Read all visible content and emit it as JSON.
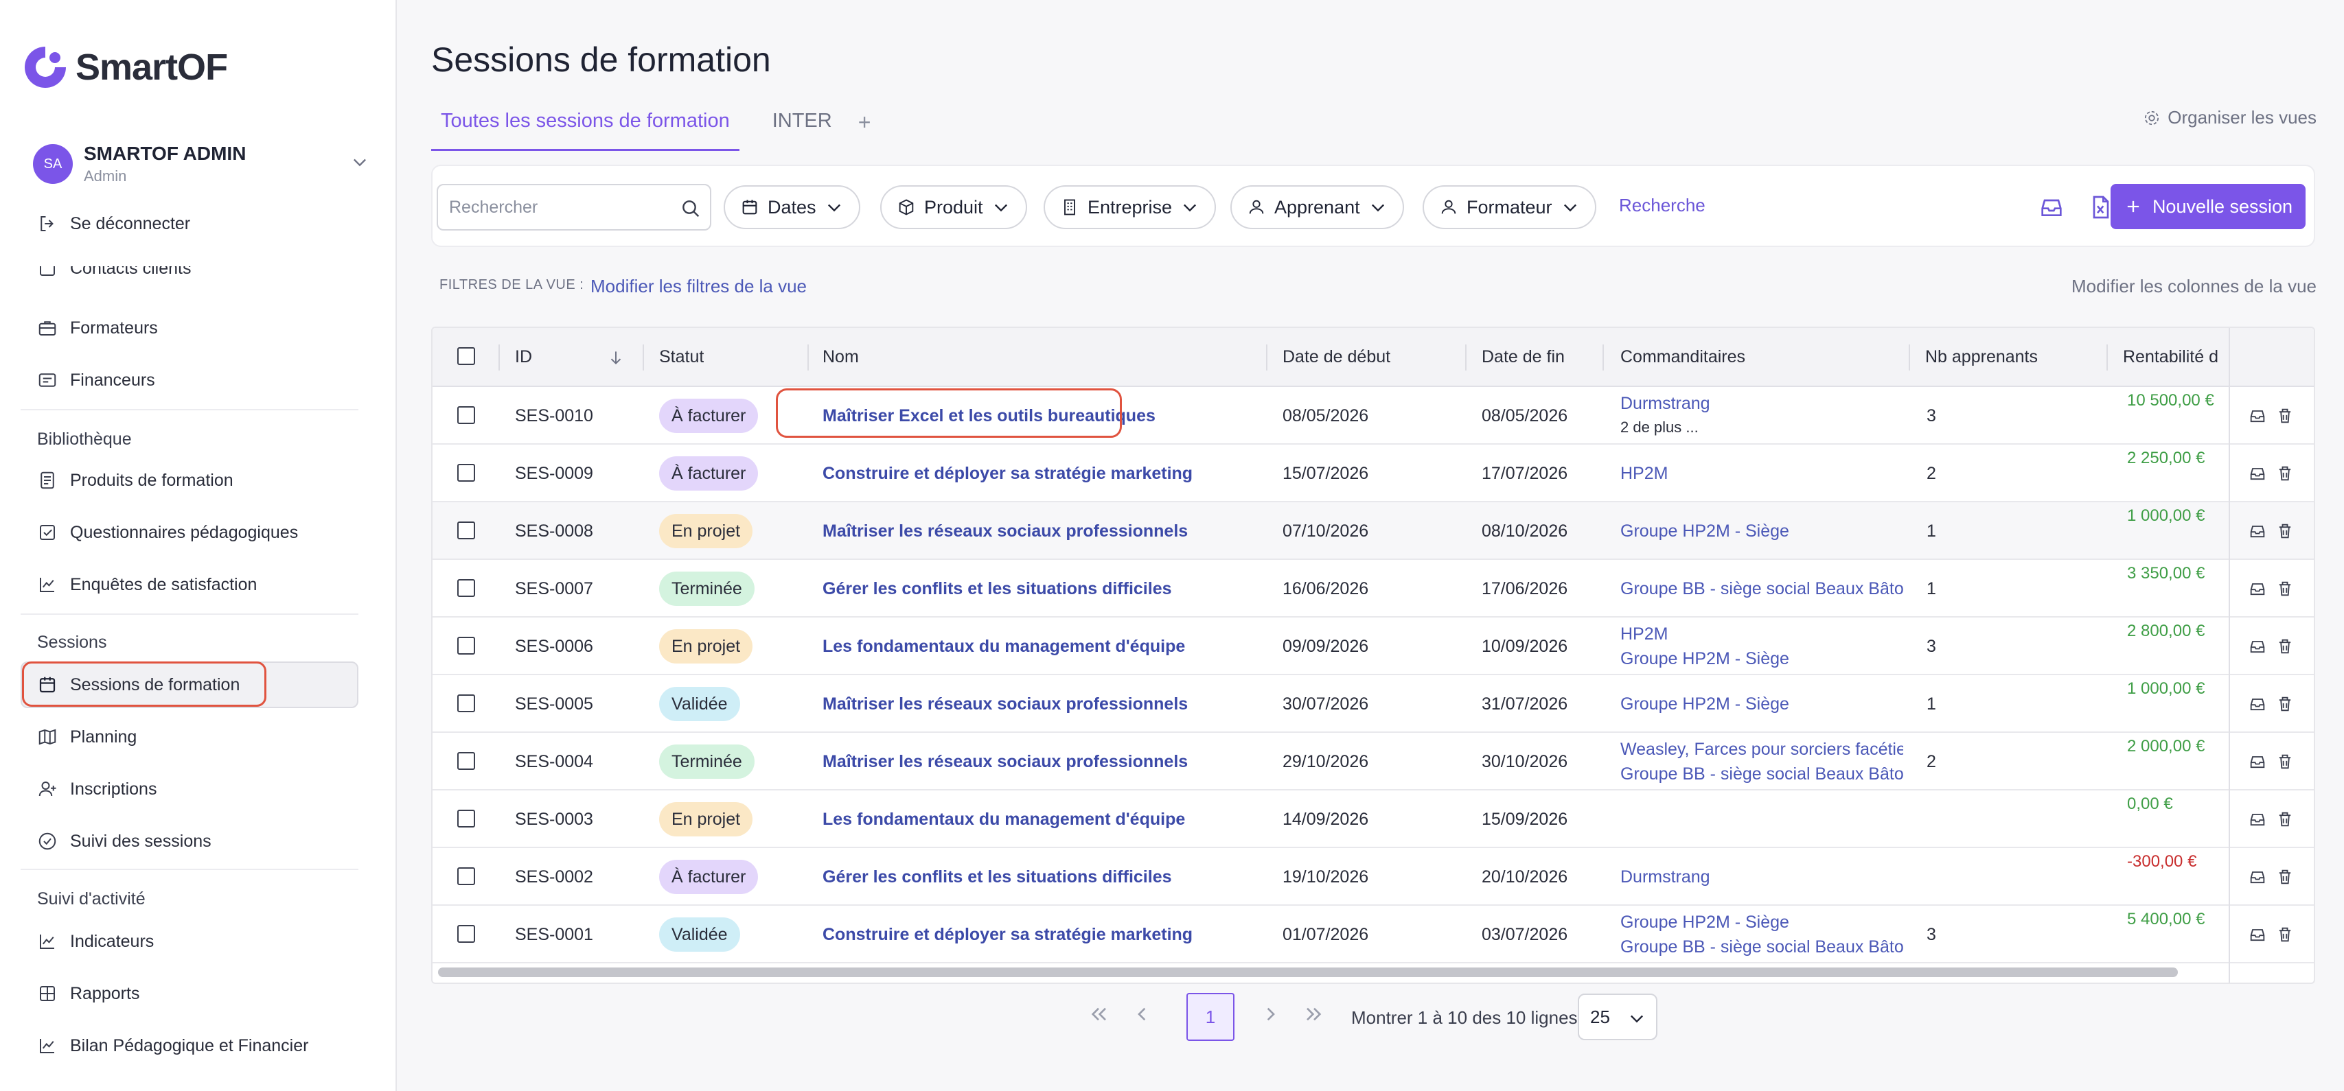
{
  "brand": {
    "name": "SmartOF"
  },
  "user": {
    "initials": "SA",
    "name": "SMARTOF ADMIN",
    "role": "Admin"
  },
  "sidebar": {
    "logout": "Se déconnecter",
    "partial": "Contacts clients",
    "items_top": [
      "Formateurs",
      "Financeurs"
    ],
    "section_library": "Bibliothèque",
    "items_library": [
      "Produits de formation",
      "Questionnaires pédagogiques",
      "Enquêtes de satisfaction"
    ],
    "section_sessions": "Sessions",
    "items_sessions": [
      "Sessions de formation",
      "Planning",
      "Inscriptions",
      "Suivi des sessions"
    ],
    "section_activity": "Suivi d'activité",
    "items_activity": [
      "Indicateurs",
      "Rapports",
      "Bilan Pédagogique et Financier"
    ]
  },
  "page": {
    "title": "Sessions de formation"
  },
  "tabs": [
    "Toutes les sessions de formation",
    "INTER"
  ],
  "tab_add": "+",
  "organize": "Organiser les vues",
  "toolbar": {
    "search_placeholder": "Rechercher",
    "filters": [
      "Dates",
      "Produit",
      "Entreprise",
      "Apprenant",
      "Formateur"
    ],
    "search_link": "Recherche",
    "new_session": "Nouvelle session"
  },
  "view": {
    "filters_label": "FILTRES DE LA VUE :",
    "filters_link": "Modifier les filtres de la vue",
    "columns_link": "Modifier les colonnes de la vue"
  },
  "table": {
    "columns": [
      "ID",
      "Statut",
      "Nom",
      "Date de début",
      "Date de fin",
      "Commanditaires",
      "Nb apprenants",
      "Rentabilité d"
    ],
    "rows": [
      {
        "id": "SES-0010",
        "status": "À facturer",
        "kind": "facturer",
        "name": "Maîtriser Excel et les outils bureautiques",
        "start": "08/05/2026",
        "end": "08/05/2026",
        "sponsor1": "Durmstrang",
        "sponsor2": "2 de plus ...",
        "count": "3",
        "profit": "10 500,00 €"
      },
      {
        "id": "SES-0009",
        "status": "À facturer",
        "kind": "facturer",
        "name": "Construire et déployer sa stratégie marketing",
        "start": "15/07/2026",
        "end": "17/07/2026",
        "sponsor1": "HP2M",
        "sponsor2": "",
        "count": "2",
        "profit": "2 250,00 €"
      },
      {
        "id": "SES-0008",
        "status": "En projet",
        "kind": "projet",
        "name": "Maîtriser les réseaux sociaux professionnels",
        "start": "07/10/2026",
        "end": "08/10/2026",
        "sponsor1": "Groupe HP2M - Siège",
        "sponsor2": "",
        "count": "1",
        "profit": "1 000,00 €"
      },
      {
        "id": "SES-0007",
        "status": "Terminée",
        "kind": "terminee",
        "name": "Gérer les conflits et les situations difficiles",
        "start": "16/06/2026",
        "end": "17/06/2026",
        "sponsor1": "Groupe BB - siège social Beaux Bâto",
        "sponsor2": "",
        "count": "1",
        "profit": "3 350,00 €"
      },
      {
        "id": "SES-0006",
        "status": "En projet",
        "kind": "projet",
        "name": "Les fondamentaux du management d'équipe",
        "start": "09/09/2026",
        "end": "10/09/2026",
        "sponsor1": "HP2M",
        "sponsor2": "Groupe HP2M - Siège",
        "count": "3",
        "profit": "2 800,00 €"
      },
      {
        "id": "SES-0005",
        "status": "Validée",
        "kind": "validee",
        "name": "Maîtriser les réseaux sociaux professionnels",
        "start": "30/07/2026",
        "end": "31/07/2026",
        "sponsor1": "Groupe HP2M - Siège",
        "sponsor2": "",
        "count": "1",
        "profit": "1 000,00 €"
      },
      {
        "id": "SES-0004",
        "status": "Terminée",
        "kind": "terminee",
        "name": "Maîtriser les réseaux sociaux professionnels",
        "start": "29/10/2026",
        "end": "30/10/2026",
        "sponsor1": "Weasley, Farces pour sorciers facétie",
        "sponsor2": "Groupe BB - siège social Beaux Bâto",
        "count": "2",
        "profit": "2 000,00 €"
      },
      {
        "id": "SES-0003",
        "status": "En projet",
        "kind": "projet",
        "name": "Les fondamentaux du management d'équipe",
        "start": "14/09/2026",
        "end": "15/09/2026",
        "sponsor1": "",
        "sponsor2": "",
        "count": "",
        "profit": "0,00 €"
      },
      {
        "id": "SES-0002",
        "status": "À facturer",
        "kind": "facturer",
        "name": "Gérer les conflits et les situations difficiles",
        "start": "19/10/2026",
        "end": "20/10/2026",
        "sponsor1": "Durmstrang",
        "sponsor2": "",
        "count": "",
        "profit": "-300,00 €"
      },
      {
        "id": "SES-0001",
        "status": "Validée",
        "kind": "validee",
        "name": "Construire et déployer sa stratégie marketing",
        "start": "01/07/2026",
        "end": "03/07/2026",
        "sponsor1": "Groupe HP2M - Siège",
        "sponsor2": "Groupe BB - siège social Beaux Bâto",
        "count": "3",
        "profit": "5 400,00 €"
      }
    ]
  },
  "pagination": {
    "current": "1",
    "info": "Montrer 1 à 10 des 10 lignes",
    "page_size": "25"
  },
  "colors": {
    "accent": "#7b55e8",
    "link": "#4b58b7",
    "positive": "#3f9e46",
    "negative": "#c82d2d",
    "highlight": "#e0533f"
  }
}
